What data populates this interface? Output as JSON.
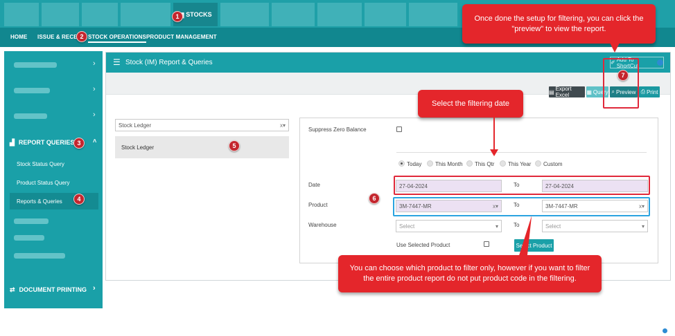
{
  "top_tabs": {
    "active_label": "STOCKS"
  },
  "subnav": {
    "items": [
      {
        "label": "HOME"
      },
      {
        "label": "ISSUE & RECEIVE"
      },
      {
        "label": "STOCK OPERATIONS"
      },
      {
        "label": "PRODUCT MANAGEMENT"
      }
    ]
  },
  "sidebar": {
    "section_title": "REPORT QUERIES",
    "links": [
      {
        "label": "Stock Status Query"
      },
      {
        "label": "Product Status Query"
      },
      {
        "label": "Reports & Queries"
      }
    ],
    "footer_section": "DOCUMENT PRINTING"
  },
  "panel": {
    "title": "Stock (IM) Report & Queries",
    "shortcut_label": "Add To ShortCut",
    "buttons": {
      "export": "Export Excel",
      "query": "Query",
      "preview": "Preview",
      "print": "Print"
    }
  },
  "report_select": {
    "value": "Stock Ledger",
    "clear": "x▾",
    "option": "Stock Ledger"
  },
  "filter": {
    "suppress_label": "Suppress Zero Balance",
    "periods": [
      "Today",
      "This Month",
      "This Qtr",
      "This Year",
      "Custom"
    ],
    "date_label": "Date",
    "date_from": "27-04-2024",
    "date_to": "27-04-2024",
    "to_label": "To",
    "product_label": "Product",
    "product_from": "3M-7447-MR",
    "product_to": "3M-7447-MR",
    "warehouse_label": "Warehouse",
    "warehouse_from": "Select",
    "warehouse_to": "Select",
    "use_selected_label": "Use Selected Product",
    "select_product_button": "Select Product"
  },
  "annotations": {
    "steps": [
      "1",
      "2",
      "3",
      "4",
      "5",
      "6",
      "7"
    ],
    "callout_preview": "Once done the setup for filtering, you can click the \"preview\" to view the report.",
    "callout_date": "Select the filtering date",
    "callout_product": "You can choose which product to filter only, however if you want to filter the entire product report do not put product code in the filtering."
  },
  "colors": {
    "teal": "#1aa0a8",
    "teal_dark": "#11878f",
    "annotation_red": "#e4262b",
    "highlight_blue": "#2aa3e0",
    "input_fill": "#ece1f3"
  }
}
